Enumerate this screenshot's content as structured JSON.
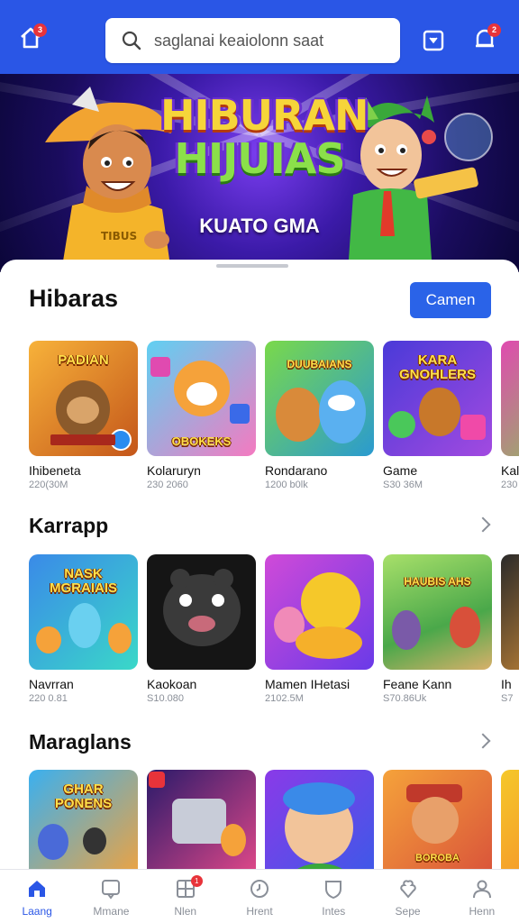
{
  "topbar": {
    "home_badge": "3",
    "search_placeholder": "saglanai keaiolonn saat",
    "notification_badge": "2",
    "bg_color": "#2a56e6"
  },
  "banner": {
    "title_line1": "HIBURAN",
    "title_line2": "HIJUIAS",
    "subtitle": "KUATO GMA"
  },
  "sections": [
    {
      "title": "Hibaras",
      "action_label": "Camen",
      "items": [
        {
          "name": "Ihibeneta",
          "meta": "220(30M",
          "art_text": "PADIAN"
        },
        {
          "name": "Kolaruryn",
          "meta": "230 2060",
          "art_text": "OBOKEKS"
        },
        {
          "name": "Rondarano",
          "meta": "1200 b0lk",
          "art_text": "DUUBAIANS"
        },
        {
          "name": "Game",
          "meta": "S30 36M",
          "art_text": "KARA GNOHLERS"
        },
        {
          "name": "Kal",
          "meta": "230",
          "art_text": ""
        }
      ]
    },
    {
      "title": "Karrapp",
      "items": [
        {
          "name": "Navrran",
          "meta": "220 0.81",
          "art_text": "NASK MGRAIAIS"
        },
        {
          "name": "Kaokoan",
          "meta": "S10.080",
          "art_text": ""
        },
        {
          "name": "Mamen IHetasi",
          "meta": "2102.5M",
          "art_text": ""
        },
        {
          "name": "Feane Kann",
          "meta": "S70.86Uk",
          "art_text": "HAUBIS AHS"
        },
        {
          "name": "Ih",
          "meta": "S7",
          "art_text": ""
        }
      ]
    },
    {
      "title": "Maraglans",
      "items": [
        {
          "name": "",
          "meta": "",
          "art_text": "GHAR PONENS"
        },
        {
          "name": "",
          "meta": "",
          "art_text": ""
        },
        {
          "name": "",
          "meta": "",
          "art_text": ""
        },
        {
          "name": "",
          "meta": "",
          "art_text": "BOROBA"
        },
        {
          "name": "",
          "meta": "",
          "art_text": ""
        }
      ]
    }
  ],
  "bottom_nav": [
    {
      "label": "Laang",
      "icon": "home-icon",
      "active": true
    },
    {
      "label": "Mmane",
      "icon": "chat-icon",
      "active": false
    },
    {
      "label": "Nlen",
      "icon": "grid-icon",
      "active": false,
      "badge": "1"
    },
    {
      "label": "Hrent",
      "icon": "clock-icon",
      "active": false
    },
    {
      "label": "Intes",
      "icon": "shield-icon",
      "active": false
    },
    {
      "label": "Sepe",
      "icon": "gift-icon",
      "active": false
    },
    {
      "label": "Henn",
      "icon": "profile-icon",
      "active": false
    }
  ]
}
